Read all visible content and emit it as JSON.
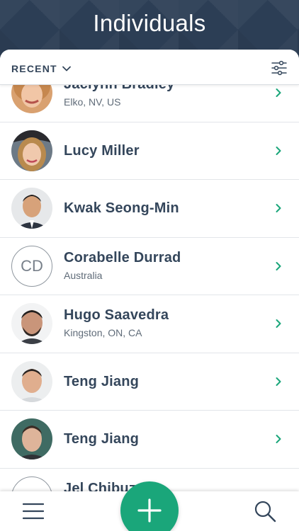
{
  "header": {
    "title": "Individuals"
  },
  "toolbar": {
    "sort_label": "RECENT"
  },
  "contacts": [
    {
      "name": "Jaclynn Bradley",
      "location": "Elko, NV, US"
    },
    {
      "name": "Lucy Miller",
      "location": ""
    },
    {
      "name": "Kwak Seong-Min",
      "location": ""
    },
    {
      "name": "Corabelle Durrad",
      "location": "Australia",
      "initials": "CD"
    },
    {
      "name": "Hugo Saavedra",
      "location": "Kingston, ON, CA"
    },
    {
      "name": "Teng Jiang",
      "location": ""
    },
    {
      "name": "Teng Jiang",
      "location": ""
    },
    {
      "name": "Jel Chibuz",
      "location": ""
    }
  ],
  "colors": {
    "accent": "#1aa67a",
    "header": "#2c3e55",
    "text": "#34465b"
  },
  "icons": [
    "chevron-down-icon",
    "filter-sliders-icon",
    "chevron-right-icon",
    "menu-icon",
    "plus-icon",
    "search-icon"
  ]
}
